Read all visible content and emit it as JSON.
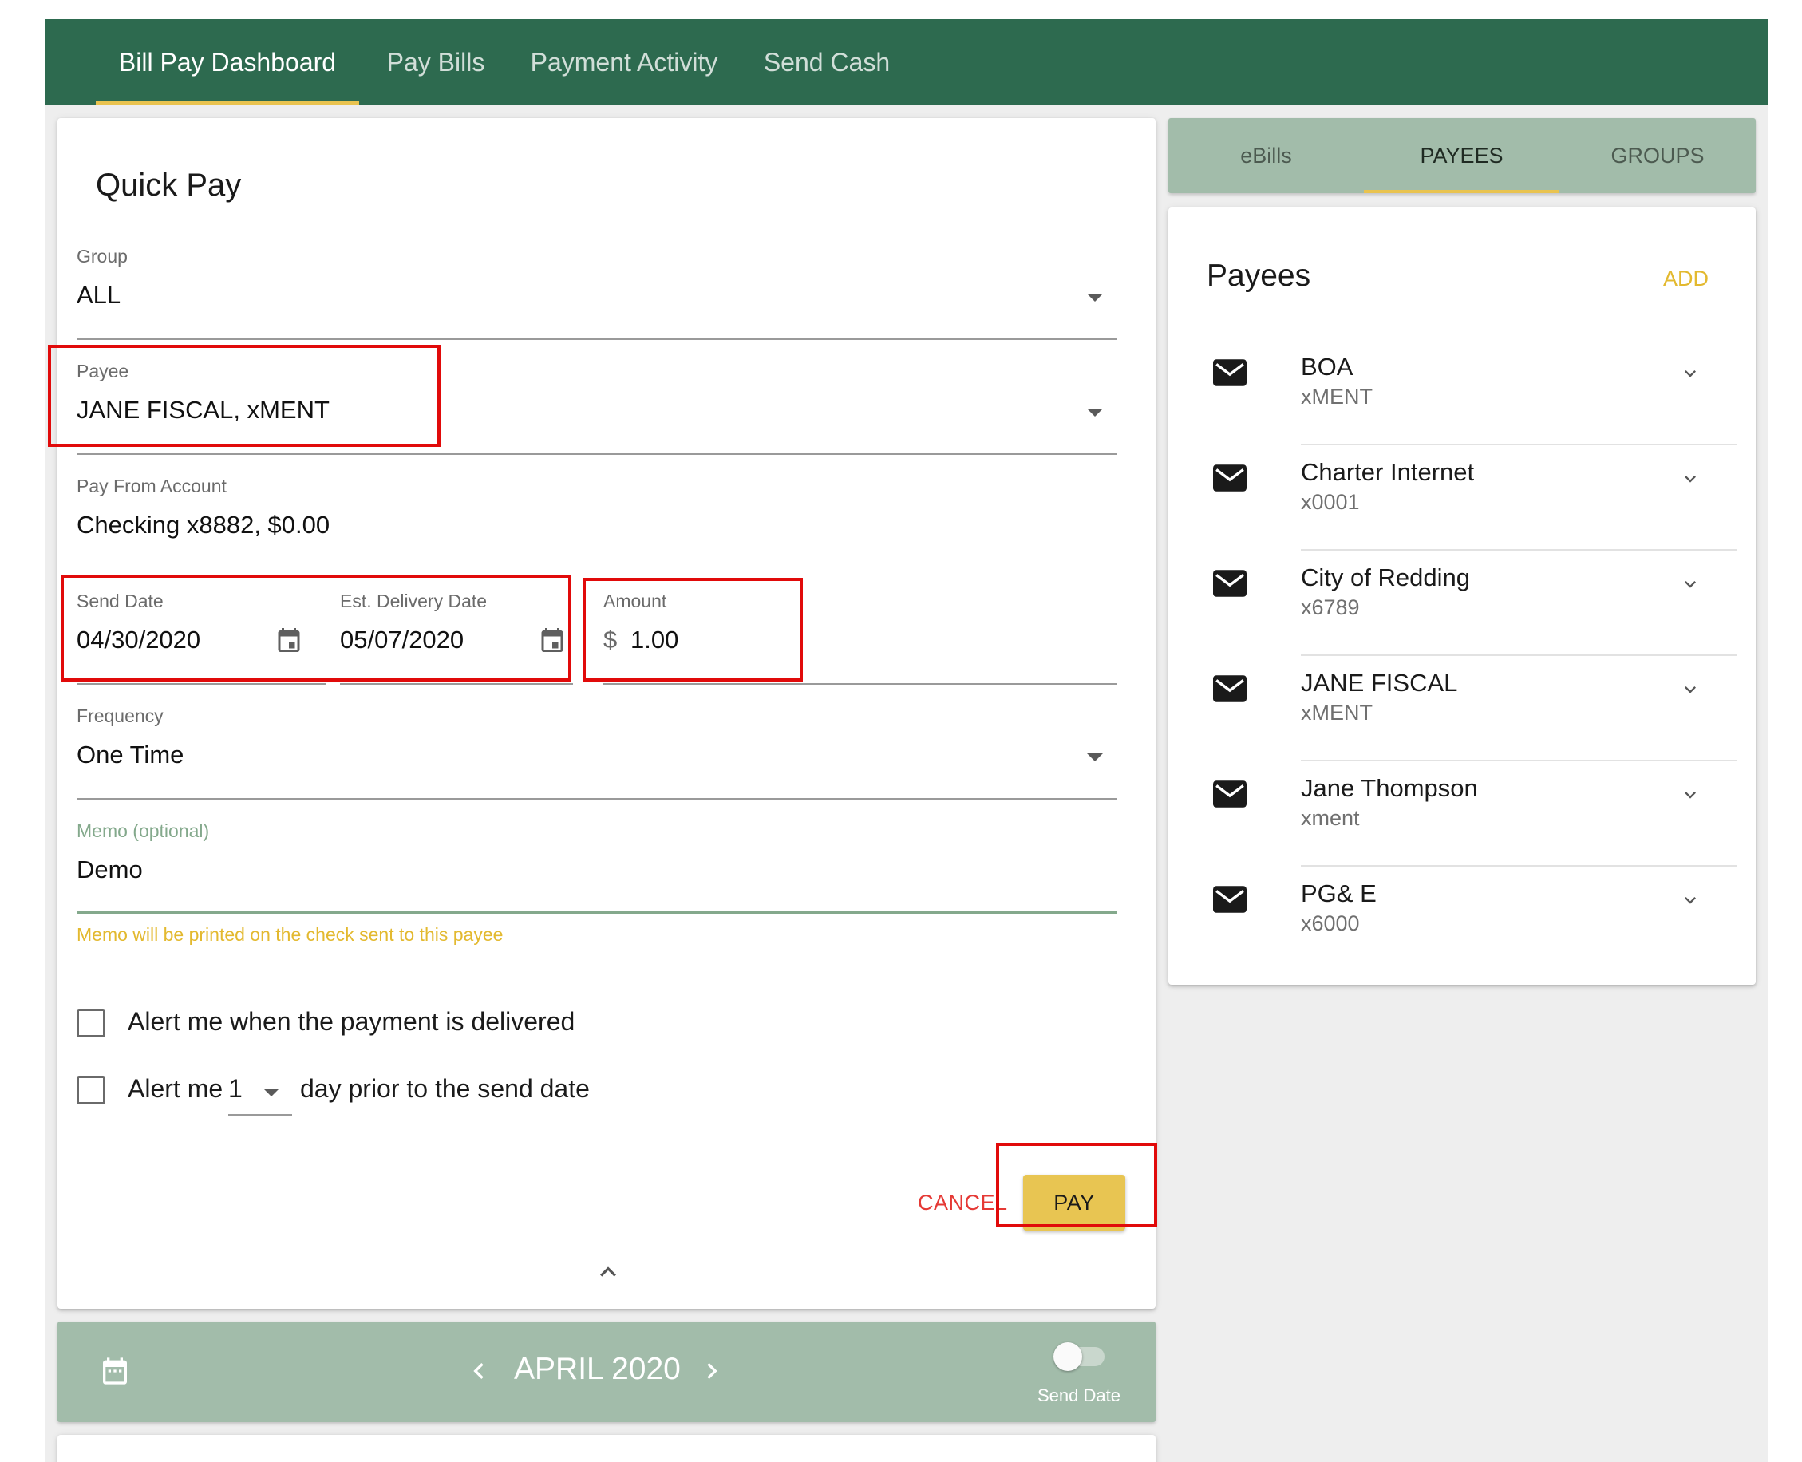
{
  "topnav": {
    "tabs": [
      {
        "label": "Bill Pay Dashboard",
        "active": true
      },
      {
        "label": "Pay Bills",
        "active": false
      },
      {
        "label": "Payment Activity",
        "active": false
      },
      {
        "label": "Send Cash",
        "active": false
      }
    ]
  },
  "quick_pay": {
    "title": "Quick Pay",
    "group": {
      "label": "Group",
      "value": "ALL"
    },
    "payee": {
      "label": "Payee",
      "value": "JANE FISCAL, xMENT"
    },
    "pay_from": {
      "label": "Pay From Account",
      "value": "Checking x8882, $0.00"
    },
    "send_date": {
      "label": "Send Date",
      "value": "04/30/2020"
    },
    "delivery_date": {
      "label": "Est. Delivery Date",
      "value": "05/07/2020"
    },
    "amount": {
      "label": "Amount",
      "currency": "$",
      "value": "1.00"
    },
    "frequency": {
      "label": "Frequency",
      "value": "One Time"
    },
    "memo": {
      "label": "Memo (optional)",
      "value": "Demo",
      "hint": "Memo will be printed on the check sent to this payee"
    },
    "alert_delivered": {
      "label": "Alert me when the payment is delivered",
      "checked": false
    },
    "alert_prior": {
      "prefix": "Alert me",
      "days": "1",
      "suffix": "day prior to the send date",
      "checked": false
    },
    "cancel_label": "CANCEL",
    "pay_label": "PAY"
  },
  "calendar_bar": {
    "month": "APRIL 2020",
    "toggle_label": "Send Date",
    "toggle_on": false
  },
  "side_tabs": [
    {
      "label": "eBills",
      "active": false
    },
    {
      "label": "PAYEES",
      "active": true
    },
    {
      "label": "GROUPS",
      "active": false
    }
  ],
  "payees_panel": {
    "title": "Payees",
    "add_label": "ADD",
    "items": [
      {
        "name": "BOA",
        "account": "xMENT"
      },
      {
        "name": "Charter Internet",
        "account": "x0001"
      },
      {
        "name": "City of Redding",
        "account": "x6789"
      },
      {
        "name": "JANE FISCAL",
        "account": "xMENT"
      },
      {
        "name": "Jane Thompson",
        "account": "xment"
      },
      {
        "name": "PG& E",
        "account": "x6000"
      }
    ]
  },
  "colors": {
    "nav_green": "#2d6a4f",
    "sage": "#a2bcaa",
    "accent_yellow": "#e8c552",
    "cancel_red": "#e53935",
    "highlight_red": "#e10a0a",
    "memo_green": "#84a98c",
    "hint_yellow": "#e3b92f"
  }
}
